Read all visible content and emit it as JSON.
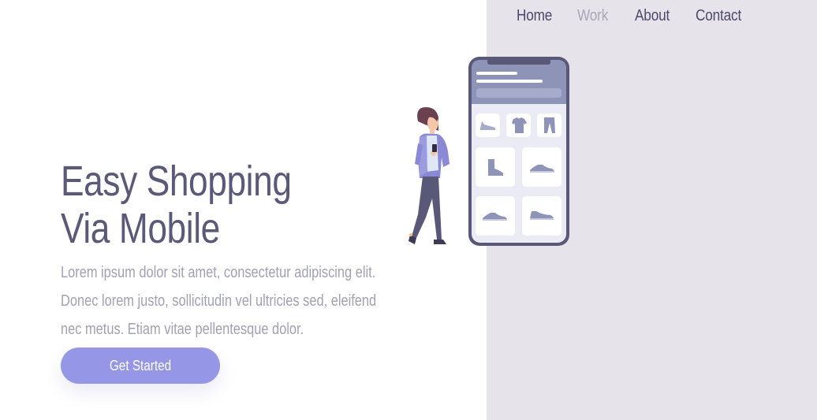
{
  "nav": {
    "items": [
      {
        "label": "Home",
        "active": true
      },
      {
        "label": "Work",
        "active": false
      },
      {
        "label": "About",
        "active": true
      },
      {
        "label": "Contact",
        "active": true
      }
    ]
  },
  "hero": {
    "title_line1": "Easy Shopping",
    "title_line2": "Via Mobile",
    "text_line1": "Lorem ipsum dolor sit amet, consectetur adipiscing elit.",
    "text_line2": "Donec lorem justo, sollicitudin vel ultricies sed, eleifend",
    "text_line3": "nec metus. Etiam vitae pellentesque dolor.",
    "cta_label": "Get Started"
  },
  "colors": {
    "accent": "#9597e6",
    "heading": "#5b5978",
    "body_text": "#a2a0b3",
    "nav_text": "#4c4a6b",
    "nav_inactive": "#a9a7b8",
    "panel_background": "#e6e4ea"
  },
  "illustration": {
    "description_icons": [
      "woman-shopper-icon",
      "smartphone-icon",
      "flat-shoe-icon",
      "tshirt-icon",
      "pants-icon",
      "boot-icon",
      "sneaker-icon"
    ]
  }
}
